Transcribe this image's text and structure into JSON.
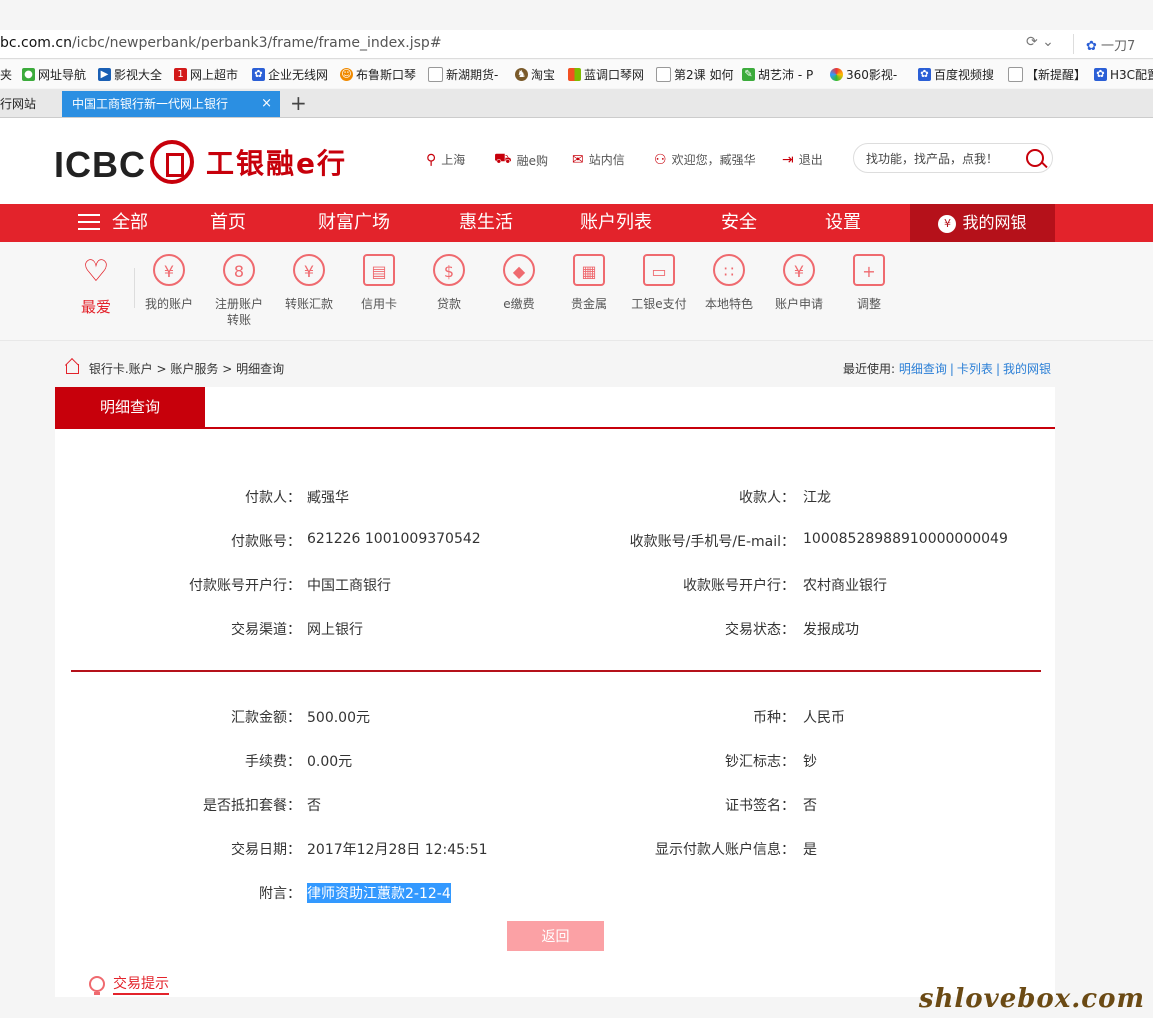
{
  "browser": {
    "url_host": "bc.com.cn",
    "url_path": "/icbc/newperbank/perbank3/frame/frame_index.jsp#",
    "search_text": "一刀7",
    "bookmarks": [
      "夹",
      "网址导航",
      "影视大全",
      "网上超市",
      "企业无线网",
      "布鲁斯口琴",
      "新湖期货-",
      "淘宝",
      "蓝调口琴网",
      "第2课 如何",
      "胡艺沛 - P",
      "360影视-",
      "百度视频搜",
      "【新提醒】",
      "H3C配置"
    ],
    "tab_inactive": "行网站",
    "tab_active": "中国工商银行新一代网上银行",
    "tab_close": "×",
    "tab_new": "+"
  },
  "header": {
    "logo_text": "ICBC",
    "brand_name": "工银融e行",
    "links": {
      "city": "上海",
      "shop": "融e购",
      "mail": "站内信",
      "welcome": "欢迎您，臧强华",
      "logout": "退出"
    },
    "search_placeholder": "找功能，找产品，点我！"
  },
  "nav": {
    "all": "全部",
    "items": [
      "首页",
      "财富广场",
      "惠生活",
      "账户列表",
      "安全",
      "设置"
    ],
    "mine": "我的网银"
  },
  "quick": {
    "favorite": "最爱",
    "items": [
      {
        "label": "我的账户",
        "glyph": "¥"
      },
      {
        "label": "注册账户转账",
        "glyph": "8"
      },
      {
        "label": "转账汇款",
        "glyph": "¥"
      },
      {
        "label": "信用卡",
        "glyph": "▤"
      },
      {
        "label": "贷款",
        "glyph": "$"
      },
      {
        "label": "e缴费",
        "glyph": "◆"
      },
      {
        "label": "贵金属",
        "glyph": "▦"
      },
      {
        "label": "工银e支付",
        "glyph": "▭"
      },
      {
        "label": "本地特色",
        "glyph": "∷"
      },
      {
        "label": "账户申请",
        "glyph": "¥"
      },
      {
        "label": "调整",
        "glyph": "+"
      }
    ]
  },
  "breadcrumb": {
    "c1": "银行卡.账户",
    "c2": "账户服务",
    "c3": "明细查询",
    "sep": ">"
  },
  "recent": {
    "label": "最近使用:",
    "links": [
      "明细查询",
      "卡列表",
      "我的网银"
    ],
    "sep": "|"
  },
  "panel": {
    "title": "明细查询",
    "payer_label": "付款人：",
    "payer": "臧强华",
    "payee_label": "收款人：",
    "payee": "江龙",
    "payer_account_label": "付款账号：",
    "payer_account": "621226 1001009370542",
    "payee_account_label": "收款账号/手机号/E-mail：",
    "payee_account": "10008528988910000000049",
    "payer_bank_label": "付款账号开户行：",
    "payer_bank": "中国工商银行",
    "payee_bank_label": "收款账号开户行：",
    "payee_bank": "农村商业银行",
    "channel_label": "交易渠道：",
    "channel": "网上银行",
    "status_label": "交易状态：",
    "status": "发报成功",
    "amount_label": "汇款金额：",
    "amount": "500.00元",
    "currency_label": "币种：",
    "currency": "人民币",
    "fee_label": "手续费：",
    "fee": "0.00元",
    "cash_flag_label": "钞汇标志：",
    "cash_flag": "钞",
    "package_label": "是否抵扣套餐：",
    "package": "否",
    "cert_label": "证书签名：",
    "cert": "否",
    "date_label": "交易日期：",
    "date": "2017年12月28日 12:45:51",
    "show_payer_label": "显示付款人账户信息：",
    "show_payer": "是",
    "note_label": "附言：",
    "note": "律师资助江蕙款2-12-4",
    "back_button": "返回",
    "tip": "交易提示"
  },
  "watermark": "shlovebox.com"
}
